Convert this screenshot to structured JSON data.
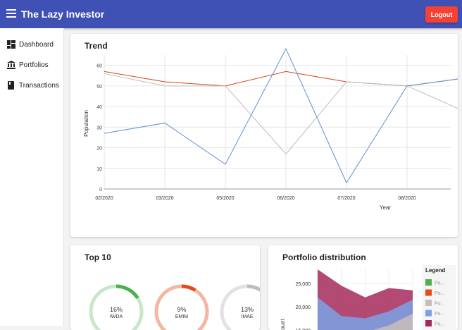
{
  "app": {
    "title": "The Lazy Investor",
    "logout_label": "Logout"
  },
  "sidebar": {
    "items": [
      {
        "label": "Dashboard",
        "icon": "dashboard-icon"
      },
      {
        "label": "Portfolios",
        "icon": "bank-icon"
      },
      {
        "label": "Transactions",
        "icon": "book-icon"
      }
    ]
  },
  "trend": {
    "title": "Trend",
    "chart_data": {
      "type": "line",
      "x": [
        "02/2020",
        "03/2020",
        "05/2020",
        "06/2020",
        "07/2020",
        "08/2020"
      ],
      "xlabel": "Year",
      "ylabel": "Population",
      "ylim": [
        0,
        65
      ],
      "yticks": [
        0,
        10,
        20,
        30,
        40,
        50,
        60
      ],
      "grid": true,
      "series": [
        {
          "values": [
            57,
            52,
            50,
            57,
            52,
            50,
            54
          ],
          "color": "#d84315"
        },
        {
          "values": [
            56,
            50,
            50,
            17,
            52,
            50,
            37
          ],
          "color": "#bdbdbd"
        },
        {
          "values": [
            27,
            32,
            12,
            68,
            3,
            50,
            54
          ],
          "color": "#5b8fd9"
        }
      ]
    }
  },
  "top10": {
    "title": "Top 10",
    "items": [
      {
        "percent": "16%",
        "name": "IWDA",
        "value": 16,
        "color": "#4caf50",
        "track": "#c8e6c9"
      },
      {
        "percent": "9%",
        "name": "EMIM",
        "value": 9,
        "color": "#e64a19",
        "track": "#f4b6a0"
      },
      {
        "percent": "13%",
        "name": "IMAE",
        "value": 13,
        "color": "#bdbdbd",
        "track": "#e2e2e2"
      }
    ]
  },
  "distribution": {
    "title": "Portfolio distribution",
    "legend_title": "Legend",
    "legend": [
      {
        "label": "Po...",
        "color": "#4caf50"
      },
      {
        "label": "Po...",
        "color": "#e64a19"
      },
      {
        "label": "Po...",
        "color": "#c9beb7"
      },
      {
        "label": "Po...",
        "color": "#7ba2e6"
      },
      {
        "label": "Po...",
        "color": "#a52a5c"
      }
    ],
    "ylabel": "ount",
    "chart_data": {
      "type": "area",
      "yticks": [
        "25,000",
        "20,000",
        "15,000"
      ],
      "ylim": [
        15000,
        28000
      ],
      "series": [
        {
          "values": [
            28000,
            24500,
            22000,
            24000,
            23500
          ],
          "color": "#a52a5c"
        },
        {
          "values": [
            22000,
            18000,
            17500,
            19000,
            21500
          ],
          "color": "#7ba2e6"
        },
        {
          "values": [
            14000,
            14000,
            14500,
            16000,
            18500
          ],
          "color": "#c9beb7"
        }
      ]
    }
  }
}
